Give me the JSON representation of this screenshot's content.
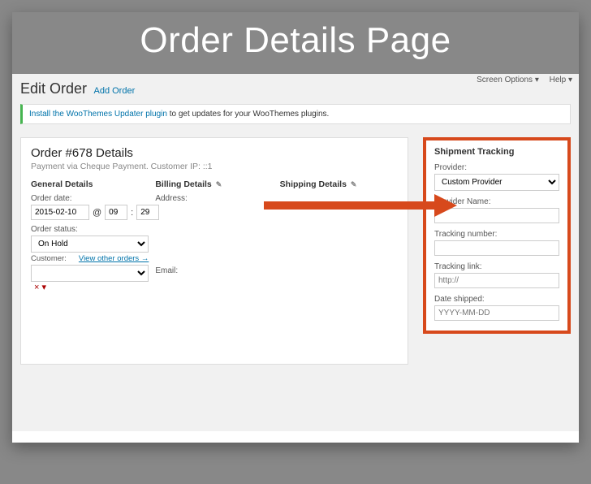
{
  "banner": {
    "title": "Order Details Page"
  },
  "topnav": {
    "screen_options": "Screen Options ▾",
    "help": "Help ▾"
  },
  "header": {
    "title": "Edit Order",
    "add_link": "Add Order"
  },
  "notice": {
    "link_text": "Install the WooThemes Updater plugin",
    "rest": " to get updates for your WooThemes plugins."
  },
  "order": {
    "title": "Order #678 Details",
    "subtitle": "Payment via Cheque Payment. Customer IP: ::1",
    "general_hdr": "General Details",
    "billing_hdr": "Billing Details",
    "shipping_hdr": "Shipping Details",
    "date_lbl": "Order date:",
    "date_val": "2015-02-10",
    "at": "@",
    "hh": "09",
    "colon": ":",
    "mm": "29",
    "status_lbl": "Order status:",
    "status_val": "On Hold",
    "customer_lbl": "Customer:",
    "view_orders": "View other orders →",
    "address_lbl": "Address:",
    "email_lbl": "Email:"
  },
  "tracking": {
    "hdr": "Shipment Tracking",
    "provider_lbl": "Provider:",
    "provider_val": "Custom Provider",
    "provider_name_lbl": "Provider Name:",
    "tracking_no_lbl": "Tracking number:",
    "tracking_link_lbl": "Tracking link:",
    "tracking_link_ph": "http://",
    "date_shipped_lbl": "Date shipped:",
    "date_shipped_ph": "YYYY-MM-DD"
  }
}
